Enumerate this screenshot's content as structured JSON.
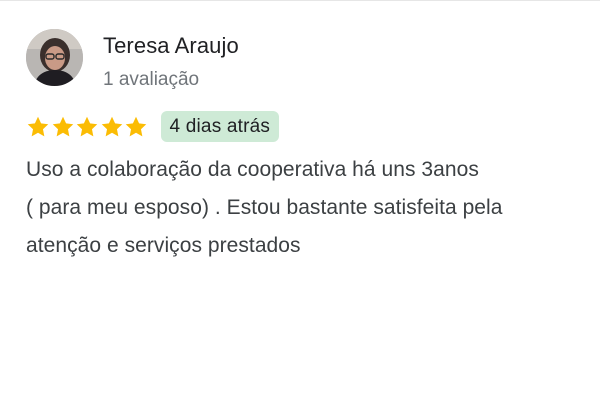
{
  "reviewer": {
    "name": "Teresa Araujo",
    "review_count": "1 avaliação",
    "avatar": "profile-photo"
  },
  "rating": {
    "stars": 5,
    "max_stars": 5,
    "star_color": "#fbbc04",
    "date": "4 dias atrás",
    "date_badge_color": "#ceead6"
  },
  "review": {
    "lines": [
      "Uso a colaboração da cooperativa há uns 3anos",
      "( para meu esposo) . Estou bastante satisfeita pela",
      "atenção e serviços prestados"
    ]
  }
}
